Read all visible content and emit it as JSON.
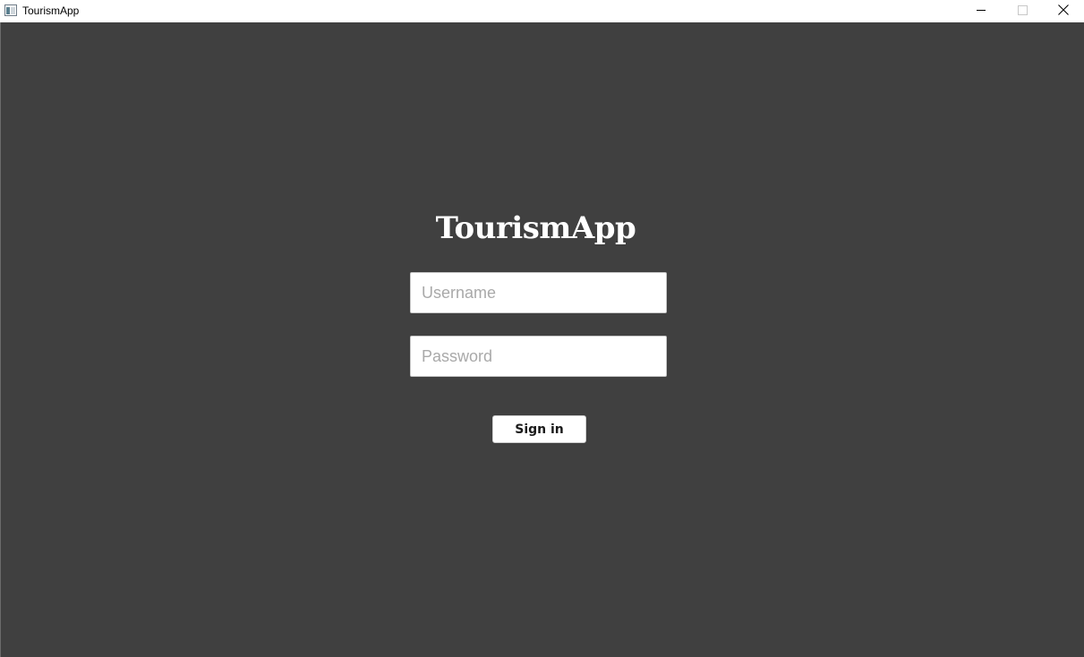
{
  "window": {
    "title": "TourismApp",
    "controls": [
      "minimize",
      "maximize",
      "close"
    ]
  },
  "login": {
    "heading": "TourismApp",
    "username": {
      "value": "",
      "placeholder": "Username"
    },
    "password": {
      "value": "",
      "placeholder": "Password"
    },
    "submit_label": "Sign in"
  },
  "icons": {
    "app": "app-window-icon",
    "minimize": "minimize-icon",
    "maximize": "maximize-icon",
    "close": "close-icon"
  },
  "colors": {
    "background": "#404040",
    "titlebar": "#ffffff",
    "heading": "#ffffff",
    "input_background": "#ffffff",
    "placeholder": "#a9a9a9",
    "button_background": "#ffffff"
  }
}
